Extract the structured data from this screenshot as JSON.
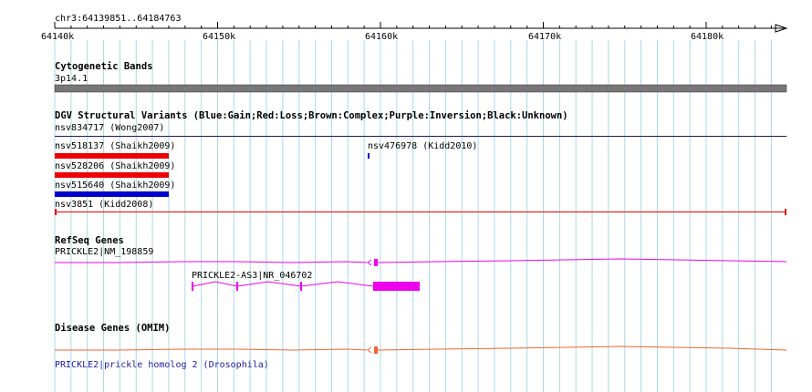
{
  "ruler": {
    "region": "chr3:64139851..64184763",
    "ticks": [
      "64140k",
      "64150k",
      "64160k",
      "64170k",
      "64180k"
    ]
  },
  "tracks": {
    "cyto": {
      "title": "Cytogenetic Bands",
      "band": "3p14.1"
    },
    "dgv": {
      "title": "DGV Structural Variants (Blue:Gain;Red:Loss;Brown:Complex;Purple:Inversion;Black:Unknown)",
      "items": [
        {
          "label": "nsv834717 (Wong2007)",
          "type": "Unknown"
        },
        {
          "label": "nsv518137 (Shaikh2009)",
          "type": "Loss"
        },
        {
          "label": "nsv476978 (Kidd2010)",
          "type": "Gain"
        },
        {
          "label": "nsv528206 (Shaikh2009)",
          "type": "Loss"
        },
        {
          "label": "nsv515640 (Shaikh2009)",
          "type": "Gain"
        },
        {
          "label": "nsv3851 (Kidd2008)",
          "type": "Loss"
        }
      ]
    },
    "refseq": {
      "title": "RefSeq Genes",
      "genes": [
        {
          "label": "PRICKLE2|NM_198859"
        },
        {
          "label": "PRICKLE2-AS3|NR_046702"
        }
      ]
    },
    "omim": {
      "title": "Disease Genes (OMIM)",
      "link": "PRICKLE2|prickle homolog 2 (Drosophila)"
    }
  },
  "colors": {
    "grid": "#a8d8ea",
    "loss": "#ee0000",
    "gain": "#0000cc",
    "unknown": "#1a1a66",
    "gene": "#ee00ee",
    "omim": "#ee6633",
    "cyto": "#777777"
  }
}
